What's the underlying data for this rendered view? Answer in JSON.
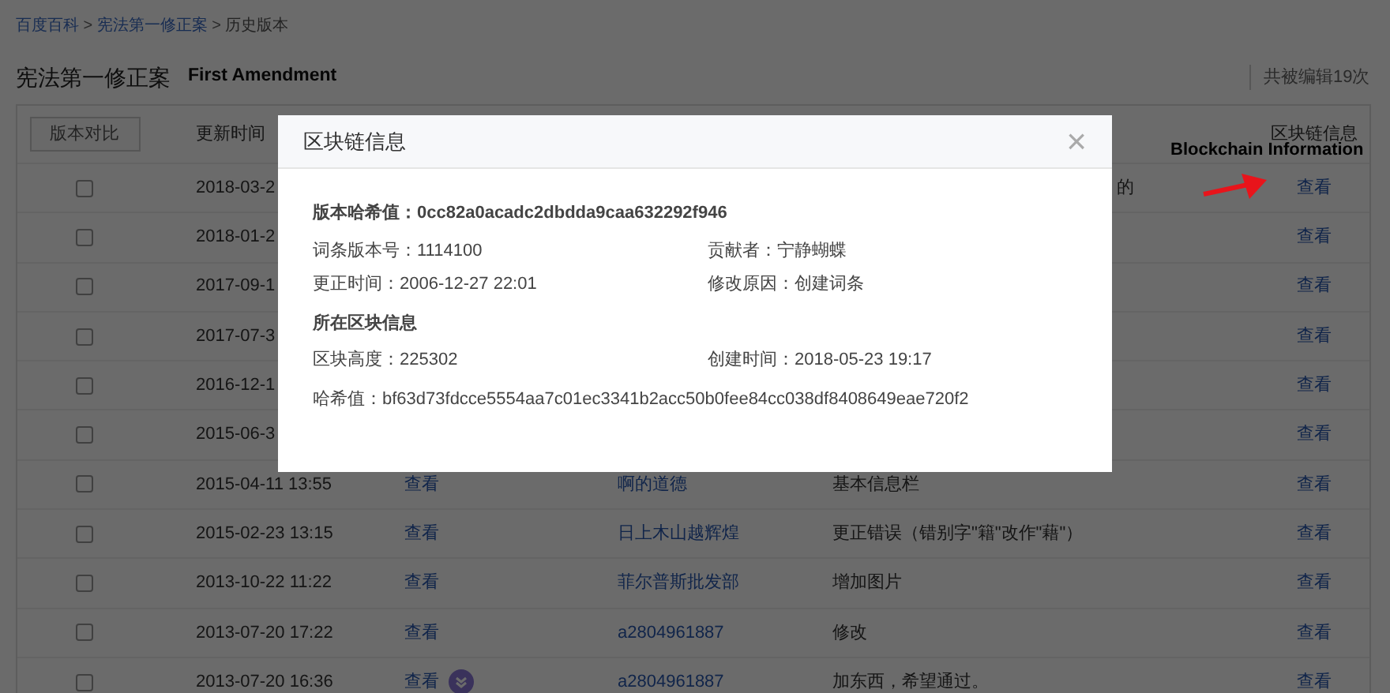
{
  "breadcrumb": [
    {
      "label": "百度百科",
      "link": true
    },
    {
      "label": "宪法第一修正案",
      "link": true
    },
    {
      "label": "历史版本",
      "link": false
    }
  ],
  "breadcrumb_separator": ">",
  "title": "宪法第一修正案",
  "title_annotation": "First Amendment",
  "edit_count": "共被编辑19次",
  "table": {
    "compare_button": "版本对比",
    "columns": [
      "更新时间"
    ],
    "last_column": "区块链信息",
    "rows": [
      {
        "checked": false,
        "date": "2018-03-2",
        "reason": "的",
        "reason_cut": true,
        "chain": "查看",
        "flag_icon": false
      },
      {
        "checked": false,
        "date": "2018-01-2",
        "chain": "查看",
        "flag_icon": false
      },
      {
        "checked": false,
        "date": "2017-09-1",
        "chain": "查看",
        "flag_icon": false
      },
      {
        "checked": false,
        "date": "2017-07-3",
        "chain": "查看",
        "flag_icon": false
      },
      {
        "checked": false,
        "date": "2016-12-1",
        "chain": "查看",
        "flag_icon": false
      },
      {
        "checked": false,
        "date": "2015-06-3",
        "chain": "查看",
        "flag_icon": false
      },
      {
        "checked": false,
        "date": "2015-04-11 13:55",
        "preview": "查看",
        "contributor": "啊的道德",
        "reason": "基本信息栏",
        "reason_cut": false,
        "chain": "查看",
        "flag_icon": false
      },
      {
        "checked": false,
        "date": "2015-02-23 13:15",
        "preview": "查看",
        "contributor": "日上木山越辉煌",
        "reason": "更正错误（错别字\"籍\"改作\"藉\"）",
        "reason_cut": false,
        "chain": "查看",
        "flag_icon": false
      },
      {
        "checked": false,
        "date": "2013-10-22 11:22",
        "preview": "查看",
        "contributor": "菲尔普斯批发部",
        "reason": "增加图片",
        "reason_cut": false,
        "chain": "查看",
        "flag_icon": false
      },
      {
        "checked": false,
        "date": "2013-07-20 17:22",
        "preview": "查看",
        "contributor": "a2804961887",
        "reason": "修改",
        "reason_cut": false,
        "chain": "查看",
        "flag_icon": false
      },
      {
        "checked": false,
        "date": "2013-07-20 16:36",
        "preview": "查看",
        "contributor": "a2804961887",
        "reason": "加东西，希望通过。",
        "reason_cut": false,
        "chain": "查看",
        "flag_icon": true
      }
    ]
  },
  "annotation": {
    "label": "Blockchain Information"
  },
  "modal": {
    "title": "区块链信息",
    "close": "×",
    "version_hash": {
      "label": "版本哈希值：",
      "value": "0cc82a0acadc2dbdda9caa632292f946"
    },
    "pairs": [
      {
        "label": "词条版本号：",
        "value": "1114100"
      },
      {
        "label": "贡献者：",
        "value": "宁静蝴蝶"
      },
      {
        "label": "更正时间：",
        "value": "2006-12-27 22:01"
      },
      {
        "label": "修改原因：",
        "value": "创建词条"
      }
    ],
    "section": "所在区块信息",
    "block_pairs": [
      {
        "label": "区块高度：",
        "value": "225302"
      },
      {
        "label": "创建时间：",
        "value": "2018-05-23 19:17"
      }
    ],
    "hash": {
      "label": "哈希值：",
      "value": "bf63d73fdcce5554aa7c01ec3341b2acc50b0fee84cc038df8408649eae720f2"
    }
  }
}
